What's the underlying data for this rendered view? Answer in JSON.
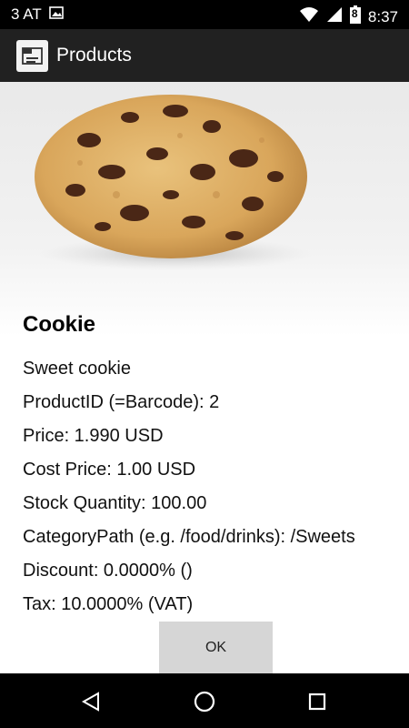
{
  "status_bar": {
    "carrier": "3 AT",
    "time": "8:37",
    "battery_level": "8"
  },
  "app_bar": {
    "title": "Products"
  },
  "product": {
    "name": "Cookie",
    "description": "Sweet cookie",
    "product_id": "ProductID (=Barcode): 2",
    "price": "Price: 1.990 USD",
    "cost_price": "Cost Price: 1.00 USD",
    "stock_quantity": "Stock Quantity: 100.00",
    "category_path": "CategoryPath (e.g. /food/drinks): /Sweets",
    "discount": "Discount: 0.0000% ()",
    "tax": "Tax: 10.0000% (VAT)"
  },
  "actions": {
    "ok_label": "OK"
  },
  "icons": {
    "image": "image-icon",
    "wifi": "wifi-icon",
    "signal": "signal-icon",
    "battery": "battery-icon",
    "app": "app-icon",
    "back": "back-icon",
    "home": "home-icon",
    "recents": "recents-icon"
  }
}
